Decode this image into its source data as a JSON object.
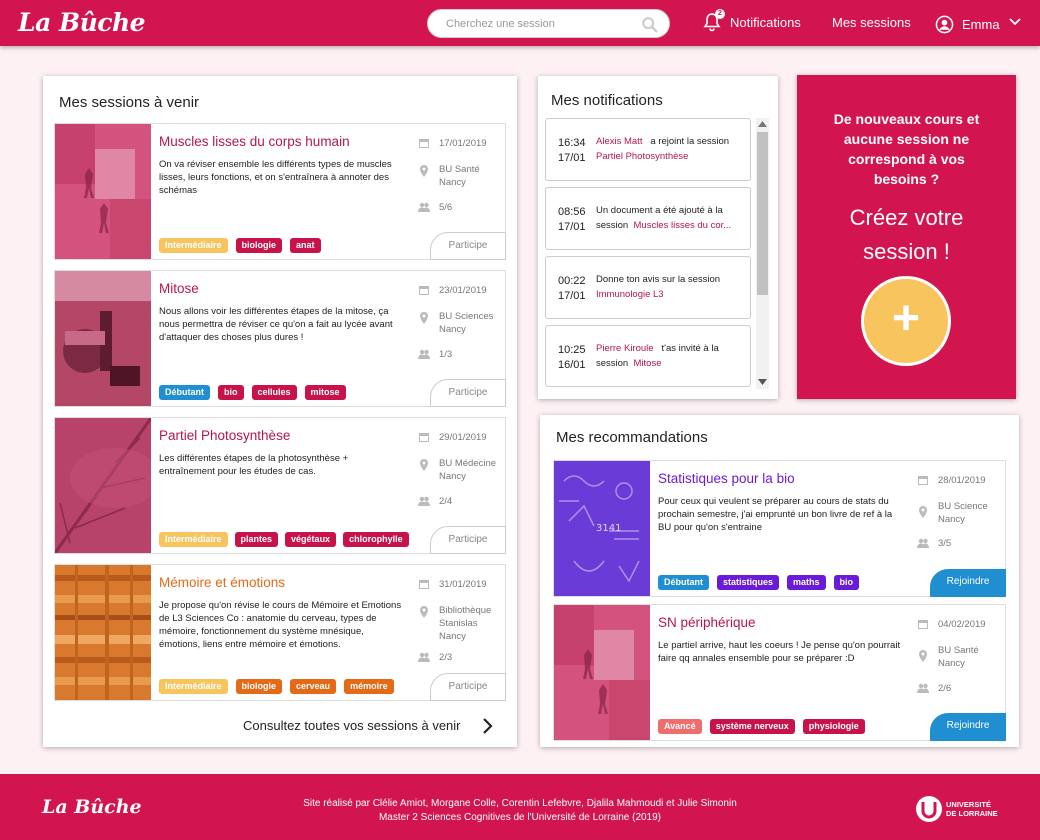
{
  "app": {
    "logo": "La Bûche"
  },
  "header": {
    "search_placeholder": "Cherchez une session",
    "notifications_label": "Notifications",
    "notifications_count": "2",
    "sessions_label": "Mes sessions",
    "user_name": "Emma"
  },
  "upcoming": {
    "title": "Mes sessions à venir",
    "footer_link": "Consultez toutes vos sessions à venir",
    "sessions": [
      {
        "title": "Muscles lisses du corps humain",
        "desc": "On va réviser ensemble les différents types de muscles lisses, leurs fonctions, et on s'entraînera à annoter des schémas",
        "date": "17/01/2019",
        "location": "BU Santé Nancy",
        "participants": "5/6",
        "button": "Participe",
        "tags": [
          {
            "label": "Intermédiaire",
            "color": "#f8c45e"
          },
          {
            "label": "biologie",
            "color": "#c8134a"
          },
          {
            "label": "anat",
            "color": "#c8134a"
          }
        ]
      },
      {
        "title": "Mitose",
        "desc": "Nous allons voir les différentes étapes de la mitose, ça nous permettra de réviser ce qu'on a fait au lycée avant d'attaquer des choses plus dures !",
        "date": "23/01/2019",
        "location": "BU Sciences Nancy",
        "participants": "1/3",
        "button": "Participe",
        "tags": [
          {
            "label": "Débutant",
            "color": "#1f8fd2"
          },
          {
            "label": "bio",
            "color": "#c8134a"
          },
          {
            "label": "cellules",
            "color": "#c8134a"
          },
          {
            "label": "mitose",
            "color": "#c8134a"
          }
        ]
      },
      {
        "title": "Partiel Photosynthèse",
        "desc": "Les différentes étapes de la photosynthèse + entraînement pour les études de cas.",
        "date": "29/01/2019",
        "location": "BU Médecine Nancy",
        "participants": "2/4",
        "button": "Participe",
        "tags": [
          {
            "label": "Intermédiaire",
            "color": "#f8c45e"
          },
          {
            "label": "plantes",
            "color": "#c8134a"
          },
          {
            "label": "végétaux",
            "color": "#c8134a"
          },
          {
            "label": "chlorophylle",
            "color": "#c8134a"
          }
        ]
      },
      {
        "title": "Mémoire et émotions",
        "desc": "Je propose qu'on révise le cours de Mémoire et Emotions de L3 Sciences Co : anatomie du cerveau, types de mémoire, fonctionnement du système mnésique, émotions, liens entre mémoire et émotions.",
        "date": "31/01/2019",
        "location": "Bibliothèque Stanislas Nancy",
        "participants": "2/3",
        "button": "Participe",
        "tags": [
          {
            "label": "Intermédiaire",
            "color": "#f8c45e"
          },
          {
            "label": "biologie",
            "color": "#e46a17"
          },
          {
            "label": "cerveau",
            "color": "#e46a17"
          },
          {
            "label": "mémoire",
            "color": "#e46a17"
          }
        ]
      }
    ]
  },
  "notifications": {
    "title": "Mes notifications",
    "items": [
      {
        "time": "16:34",
        "date": "17/01",
        "actor": "Alexis Matt",
        "text": "a rejoint la session",
        "session": "Partiel Photosynthèse"
      },
      {
        "time": "08:56",
        "date": "17/01",
        "actor": "",
        "text": "Un document a été ajouté à la session",
        "session": "Muscles lisses du cor..."
      },
      {
        "time": "00:22",
        "date": "17/01",
        "actor": "",
        "text": "Donne ton avis sur la session",
        "session": "Immunologie L3"
      },
      {
        "time": "10:25",
        "date": "16/01",
        "actor": "Pierre Kiroule",
        "text": "t'as invité à la session",
        "session": "Mitose"
      }
    ]
  },
  "create": {
    "prompt": "De nouveaux cours et aucune session ne correspond à vos besoins ?",
    "cta": "Créez votre session !",
    "plus": "+"
  },
  "recommendations": {
    "title": "Mes recommandations",
    "sessions": [
      {
        "title": "Statistiques pour la bio",
        "desc": "Pour ceux qui veulent se préparer au cours de stats du prochain semestre, j'ai emprunté un bon livre de ref à la BU pour qu'on s'entraine",
        "date": "28/01/2019",
        "location": "BU Science Nancy",
        "participants": "3/5",
        "button": "Rejoindre",
        "tags": [
          {
            "label": "Débutant",
            "color": "#1f8fd2"
          },
          {
            "label": "statistiques",
            "color": "#6a1bd8"
          },
          {
            "label": "maths",
            "color": "#6a1bd8"
          },
          {
            "label": "bio",
            "color": "#6a1bd8"
          }
        ]
      },
      {
        "title": "SN périphérique",
        "desc": "Le partiel arrive, haut les coeurs ! Je pense qu'on pourrait faire qq annales ensemble pour se préparer :D",
        "date": "04/02/2019",
        "location": "BU Santé Nancy",
        "participants": "2/6",
        "button": "Rejoindre",
        "tags": [
          {
            "label": "Avancé",
            "color": "#f06d6d"
          },
          {
            "label": "système nerveux",
            "color": "#c8134a"
          },
          {
            "label": "physiologie",
            "color": "#c8134a"
          }
        ]
      }
    ]
  },
  "footer": {
    "logo": "La Bûche",
    "credits_line1": "Site réalisé par Clélie Amiot, Morgane Colle, Corentin Lefebvre, Djalila Mahmoudi et Julie Simonin",
    "credits_line2": "Master 2 Sciences Cognitives de l'Université de Lorraine (2019)",
    "university": "UNIVERSITÉ DE LORRAINE"
  },
  "colors": {
    "brand": "#d3154f",
    "background": "#fdf1f4",
    "join": "#1f8fd2",
    "create_button": "#f8c45e",
    "recommendation_title": "#6a1bd8"
  }
}
